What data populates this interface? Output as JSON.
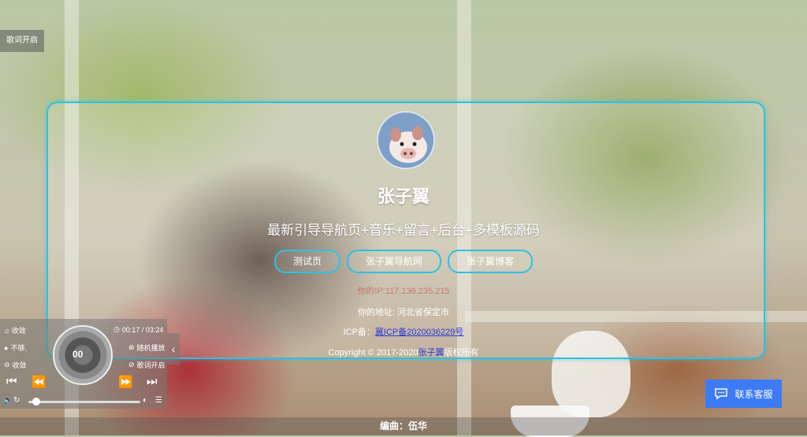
{
  "lyrics_toggle": "歌词开启",
  "profile": {
    "name": "张子翼",
    "subtitle": "最新引导导航页+音乐+留言+后台+多模板源码"
  },
  "links": [
    "测试页",
    "张子翼导航网",
    "张子翼博客"
  ],
  "info": {
    "ip_label": "你的IP:",
    "ip_value": "117.136.235.215",
    "address": "你的地址: 河北省保定市",
    "icp_label": "ICP备：",
    "icp_value": "冀ICP备2020036229号",
    "copyright_prefix": "Copyright © 2017-2020",
    "copyright_owner": "张子翼",
    "copyright_suffix": "版权所有"
  },
  "player": {
    "collect_top": "收敛",
    "time": "00:17 / 03:24",
    "user": "不够,",
    "shuffle": "随机播放",
    "collect_bottom": "收敛",
    "lyrics_on": "歌词开启",
    "disc_label": "00"
  },
  "now_playing": "编曲：伍华",
  "customer_service": "联系客服",
  "colors": {
    "accent": "#2dc2e0",
    "service_bg": "#3d7bf5",
    "link": "#2a3bd6"
  }
}
